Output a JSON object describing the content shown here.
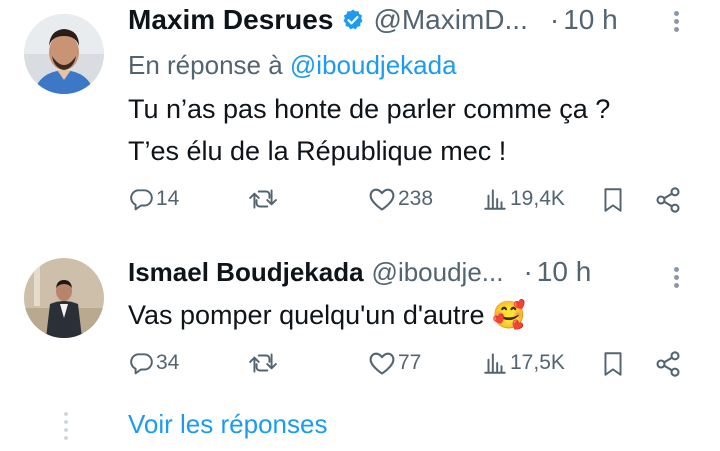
{
  "tweets": [
    {
      "author_name": "Maxim Desrues",
      "verified": true,
      "handle": "@MaximD...",
      "separator": "·",
      "time": "10 h",
      "reply_prefix": "En réponse à",
      "reply_handle": "@iboudjekada",
      "text_lines": [
        "Tu n’as pas honte de parler comme ça ?",
        "T’es élu de la République mec !"
      ],
      "stats": {
        "replies": "14",
        "retweets": "",
        "likes": "238",
        "views": "19,4K"
      }
    },
    {
      "author_name": "Ismael Boudjekada",
      "verified": false,
      "handle": "@iboudje...",
      "separator": "·",
      "time": "10 h",
      "text_lines": [
        "Vas pomper quelqu'un d'autre 🥰"
      ],
      "stats": {
        "replies": "34",
        "retweets": "",
        "likes": "77",
        "views": "17,5K"
      }
    }
  ],
  "show_replies_label": "Voir les réponses",
  "colors": {
    "accent": "#1d9bf0",
    "muted": "#536471",
    "text": "#0f1419"
  },
  "icons": [
    "verified-badge-icon",
    "reply-icon",
    "retweet-icon",
    "like-icon",
    "views-icon",
    "bookmark-icon",
    "share-icon",
    "more-icon"
  ]
}
